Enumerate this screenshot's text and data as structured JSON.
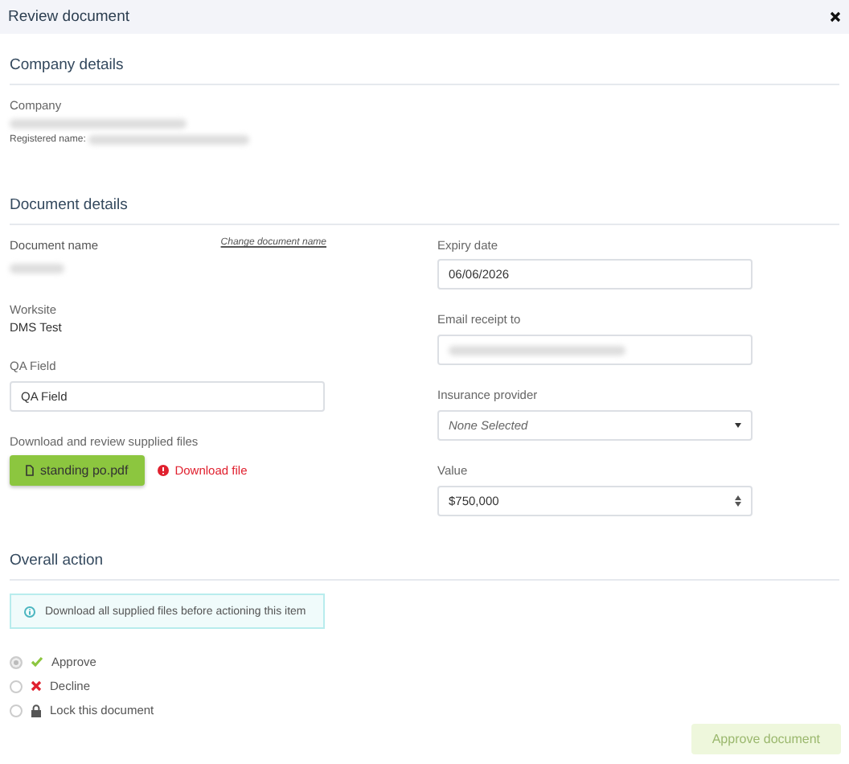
{
  "window": {
    "title": "Review document"
  },
  "company_details": {
    "heading": "Company details",
    "company_label": "Company",
    "registered_label": "Registered name:"
  },
  "document_details": {
    "heading": "Document details",
    "document_name_label": "Document name",
    "change_link": "Change document name",
    "worksite_label": "Worksite",
    "worksite": "DMS Test",
    "qa_label": "QA Field",
    "qa_value": "QA Field",
    "files_label": "Download and review supplied files",
    "file_button": "standing po.pdf",
    "download_link": "Download file",
    "expiry_label": "Expiry date",
    "expiry_value": "06/06/2026",
    "email_label": "Email receipt to",
    "insurance_label": "Insurance provider",
    "insurance_placeholder": "None Selected",
    "value_label": "Value",
    "value": "$750,000"
  },
  "overall_action": {
    "heading": "Overall action",
    "info": "Download all supplied files before actioning this item",
    "options": [
      {
        "kind": "approve",
        "label": "Approve",
        "selected": true
      },
      {
        "kind": "decline",
        "label": "Decline",
        "selected": false
      },
      {
        "kind": "lock",
        "label": "Lock this document",
        "selected": false
      }
    ]
  },
  "submit": {
    "label": "Approve document",
    "disabled": true
  }
}
